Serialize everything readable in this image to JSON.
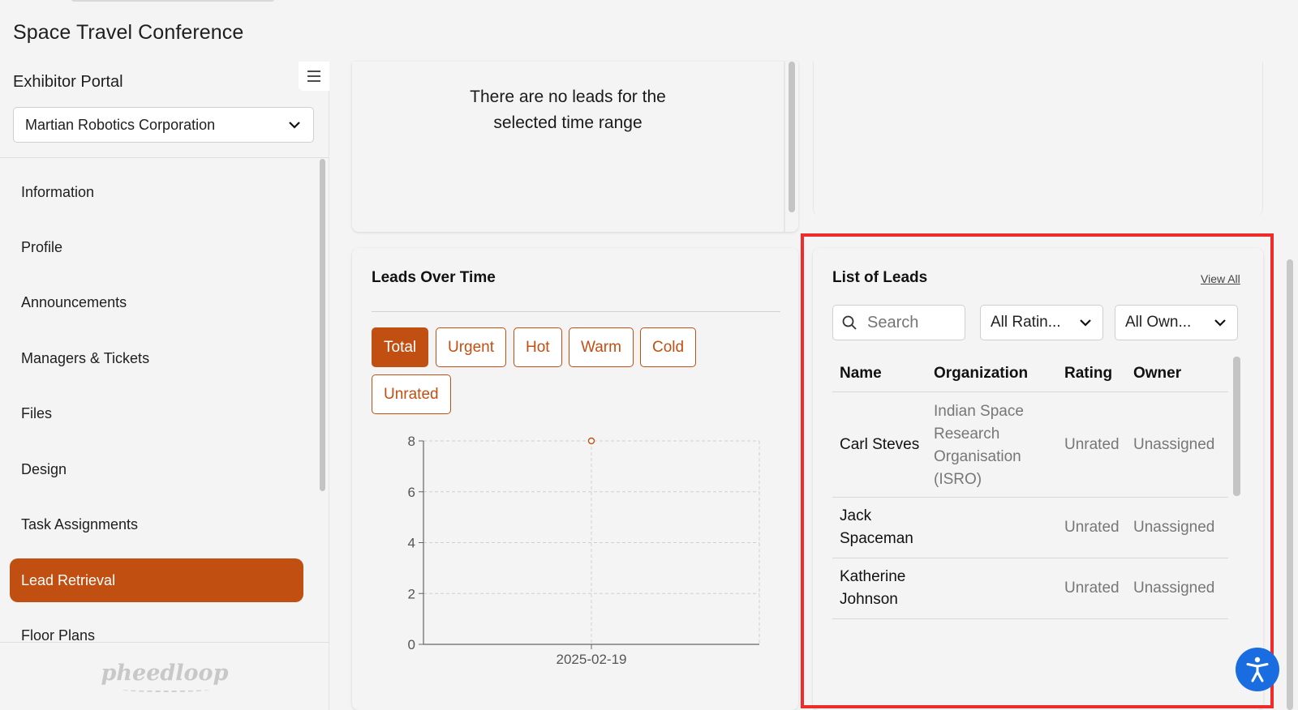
{
  "app": {
    "title": "Space Travel Conference"
  },
  "sidebar": {
    "portal_label": "Exhibitor Portal",
    "org_selector": {
      "value": "Martian Robotics Corporation"
    },
    "items": [
      {
        "label": "Information",
        "active": false
      },
      {
        "label": "Profile",
        "active": false
      },
      {
        "label": "Announcements",
        "active": false
      },
      {
        "label": "Managers & Tickets",
        "active": false
      },
      {
        "label": "Files",
        "active": false
      },
      {
        "label": "Design",
        "active": false
      },
      {
        "label": "Task Assignments",
        "active": false
      },
      {
        "label": "Lead Retrieval",
        "active": true
      },
      {
        "label": "Floor Plans",
        "active": false
      }
    ],
    "brand": "pheedloop"
  },
  "empty_state": {
    "line1": "There are no leads for the",
    "line2": "selected time range"
  },
  "leads_over_time": {
    "title": "Leads Over Time",
    "filters": [
      {
        "label": "Total",
        "active": true
      },
      {
        "label": "Urgent",
        "active": false
      },
      {
        "label": "Hot",
        "active": false
      },
      {
        "label": "Warm",
        "active": false
      },
      {
        "label": "Cold",
        "active": false
      },
      {
        "label": "Unrated",
        "active": false
      }
    ]
  },
  "chart_data": {
    "type": "line",
    "x": [
      "2025-02-19"
    ],
    "series": [
      {
        "values": [
          8
        ]
      }
    ],
    "ylim": [
      0,
      8
    ],
    "yticks": [
      0,
      2,
      4,
      6,
      8
    ],
    "xticks": [
      "2025-02-19"
    ],
    "grid": true,
    "color": "#c24f12"
  },
  "list_of_leads": {
    "title": "List of Leads",
    "view_all": "View All",
    "search_placeholder": "Search",
    "rating_filter": "All Ratin...",
    "owner_filter": "All Own...",
    "columns": [
      "Name",
      "Organization",
      "Rating",
      "Owner"
    ],
    "rows": [
      {
        "name": [
          "Carl Steves"
        ],
        "organization": [
          "Indian Space",
          "Research",
          "Organisation",
          "(ISRO)"
        ],
        "rating": "Unrated",
        "owner": "Unassigned"
      },
      {
        "name": [
          "Jack",
          "Spaceman"
        ],
        "organization": [],
        "rating": "Unrated",
        "owner": "Unassigned"
      },
      {
        "name": [
          "Katherine",
          "Johnson"
        ],
        "organization": [],
        "rating": "Unrated",
        "owner": "Unassigned"
      }
    ]
  },
  "colors": {
    "accent": "#c24f12",
    "highlight": "#ee2c2c",
    "a11y": "#1a6de0"
  }
}
